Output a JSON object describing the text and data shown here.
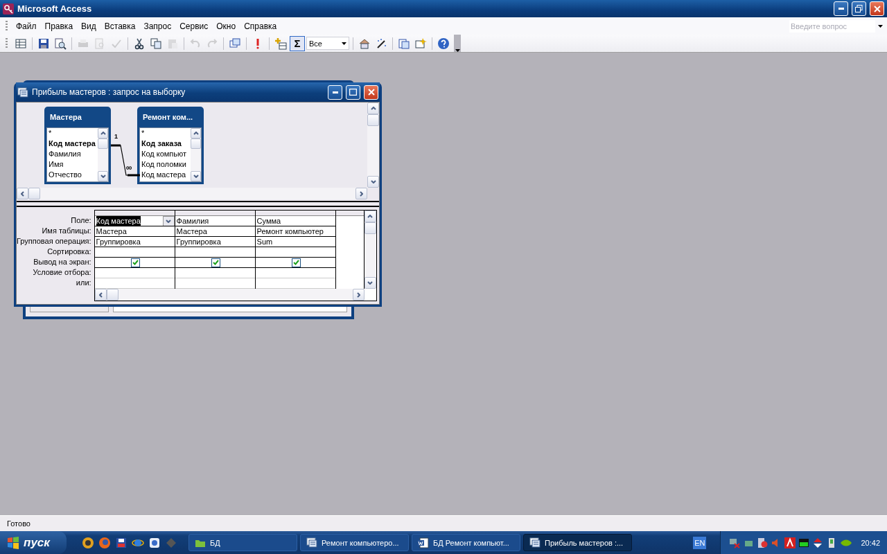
{
  "app_window": {
    "title": "Microsoft Access"
  },
  "menu": [
    {
      "label": "Файл"
    },
    {
      "label": "Правка"
    },
    {
      "label": "Вид"
    },
    {
      "label": "Вставка"
    },
    {
      "label": "Запрос"
    },
    {
      "label": "Сервис"
    },
    {
      "label": "Окно"
    },
    {
      "label": "Справка"
    }
  ],
  "help_search": {
    "placeholder": "Введите вопрос"
  },
  "toolbar": {
    "buttons": [
      {
        "disabled": false
      },
      {
        "disabled": false
      },
      {
        "disabled": false
      },
      {
        "disabled": true
      },
      {
        "disabled": true
      },
      {
        "disabled": true
      },
      {
        "disabled": false
      },
      {
        "disabled": false
      },
      {
        "disabled": true
      },
      {
        "disabled": true
      },
      {
        "disabled": true
      },
      {
        "disabled": false
      },
      {
        "disabled": false
      },
      {
        "disabled": false
      }
    ],
    "totals_button": {
      "label": "Σ",
      "pressed": true
    },
    "top_values": {
      "value": "Все"
    },
    "tail_buttons": [
      {
        "disabled": false
      },
      {
        "disabled": false
      },
      {
        "disabled": false
      },
      {
        "disabled": false
      },
      {
        "disabled": false
      }
    ]
  },
  "query_window": {
    "title": "Прибыль мастеров : запрос на выборку",
    "tables": [
      {
        "title": "Мастера",
        "fields": [
          {
            "name": "*",
            "primary_key": false
          },
          {
            "name": "Код мастера",
            "primary_key": true
          },
          {
            "name": "Фамилия",
            "primary_key": false
          },
          {
            "name": "Имя",
            "primary_key": false
          },
          {
            "name": "Отчество",
            "primary_key": false
          }
        ]
      },
      {
        "title": "Ремонт ком...",
        "fields": [
          {
            "name": "*",
            "primary_key": false
          },
          {
            "name": "Код заказа",
            "primary_key": true
          },
          {
            "name": "Код компьют",
            "primary_key": false
          },
          {
            "name": "Код поломки",
            "primary_key": false
          },
          {
            "name": "Код мастера",
            "primary_key": false
          }
        ]
      }
    ],
    "relationship": {
      "one_label": "1",
      "many_label": "∞"
    },
    "grid": {
      "row_labels": [
        "Поле:",
        "Имя таблицы:",
        "Групповая операция:",
        "Сортировка:",
        "Вывод на экран:",
        "Условие отбора:",
        "или:"
      ],
      "columns": [
        {
          "field": "Код мастера",
          "selected": true,
          "table": "Мастера",
          "total": "Группировка",
          "show": true
        },
        {
          "field": "Фамилия",
          "selected": false,
          "table": "Мастера",
          "total": "Группировка",
          "show": true
        },
        {
          "field": "Сумма",
          "selected": false,
          "table": "Ремонт компьютер",
          "total": "Sum",
          "show": true
        }
      ]
    }
  },
  "status_bar": {
    "text": "Готово"
  },
  "taskbar": {
    "start_label": "пуск",
    "tasks": [
      {
        "label": "БД",
        "kind": "folder",
        "selected": false
      },
      {
        "label": "Ремонт компьютеро...",
        "kind": "form",
        "selected": false
      },
      {
        "label": "БД Ремонт компьют...",
        "kind": "word",
        "selected": false
      },
      {
        "label": "Прибыль мастеров :...",
        "kind": "form",
        "selected": true
      }
    ],
    "language": "EN",
    "clock": "20:42"
  }
}
